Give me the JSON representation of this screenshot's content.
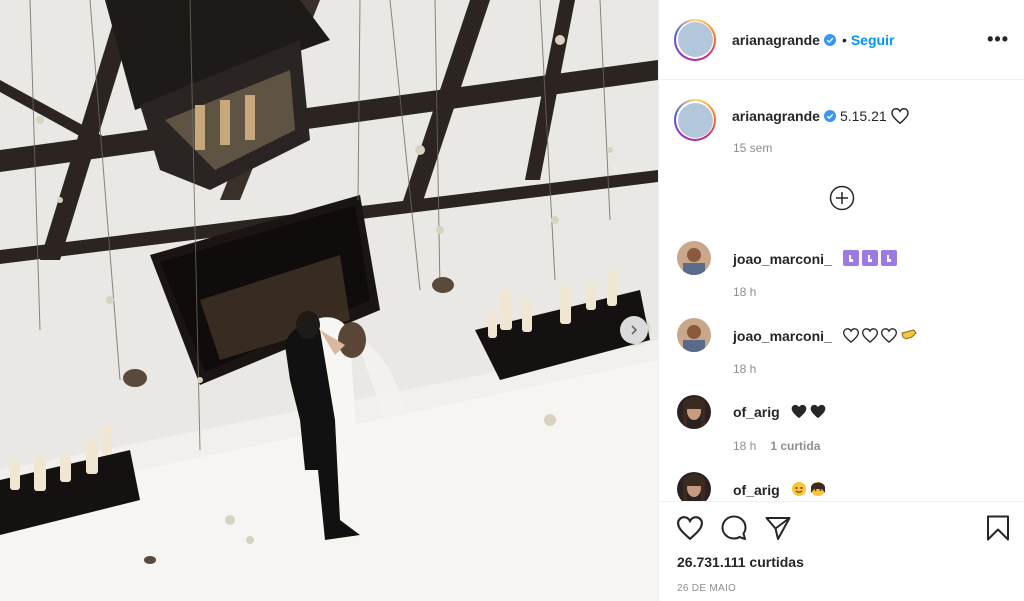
{
  "post": {
    "image_alt": "Wedding photo"
  },
  "header": {
    "username": "arianagrande",
    "separator": "•",
    "follow_label": "Seguir",
    "more_label": "•••"
  },
  "caption": {
    "username": "arianagrande",
    "text": "5.15.21",
    "time": "15 sem"
  },
  "comments": [
    {
      "username": "joao_marconi_",
      "text": "",
      "emojis": [
        "hand",
        "hand",
        "hand"
      ],
      "time": "18 h",
      "likes": ""
    },
    {
      "username": "joao_marconi_",
      "text": "",
      "emojis": [
        "heart-outline",
        "heart-outline",
        "heart-outline",
        "pinch-hand"
      ],
      "time": "18 h",
      "likes": ""
    },
    {
      "username": "of_arig",
      "text": "",
      "emojis": [
        "black-heart",
        "black-heart"
      ],
      "time": "18 h",
      "likes": "1 curtida"
    },
    {
      "username": "of_arig",
      "text": "",
      "emojis": [
        "face",
        "face"
      ],
      "time": "",
      "likes": ""
    }
  ],
  "footer": {
    "likes_count": "26.731.111 curtidas",
    "date": "26 DE MAIO"
  },
  "colors": {
    "link_blue": "#0095f6",
    "verified_blue": "#3897f0",
    "muted_text": "#8e8e8e",
    "border": "#efefef"
  },
  "icons": [
    "verified-icon",
    "more-icon",
    "heart-icon",
    "comment-icon",
    "share-icon",
    "bookmark-icon",
    "plus-circle-icon",
    "next-arrow-icon"
  ]
}
